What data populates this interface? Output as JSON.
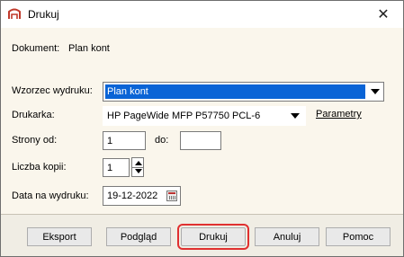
{
  "window": {
    "title": "Drukuj",
    "close_glyph": "✕"
  },
  "document": {
    "label": "Dokument:",
    "value": "Plan kont"
  },
  "template": {
    "label": "Wzorzec wydruku:",
    "value": "Plan kont"
  },
  "printer": {
    "label": "Drukarka:",
    "value": "HP PageWide MFP P57750 PCL-6",
    "params_link": "Parametry"
  },
  "pages": {
    "from_label": "Strony od:",
    "from_value": "1",
    "to_label": "do:",
    "to_value": ""
  },
  "copies": {
    "label": "Liczba kopii:",
    "value": "1"
  },
  "print_date": {
    "label": "Data na wydruku:",
    "value": "19-12-2022"
  },
  "buttons": {
    "export": "Eksport",
    "preview": "Podgląd",
    "print": "Drukuj",
    "cancel": "Anuluj",
    "help": "Pomoc"
  },
  "colors": {
    "focus_outline": "#e03030",
    "selection": "#0a64d6",
    "body_bg": "#faf6ec"
  }
}
